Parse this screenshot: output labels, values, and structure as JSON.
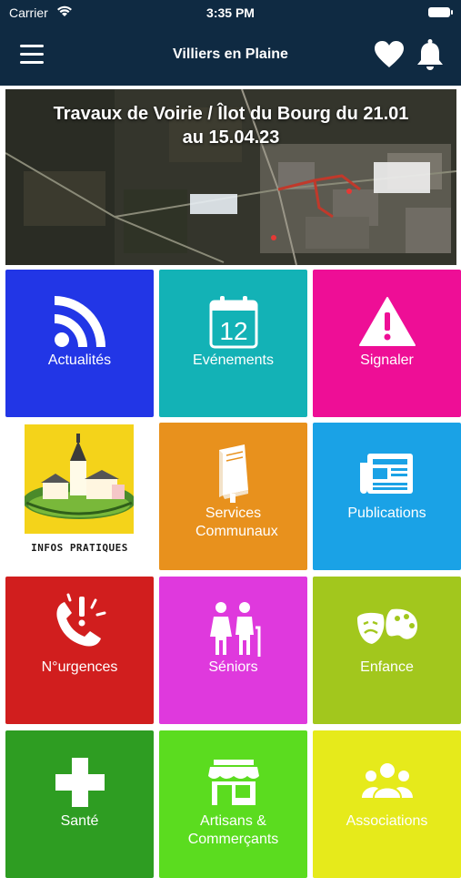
{
  "status_bar": {
    "carrier": "Carrier",
    "time": "3:35 PM"
  },
  "nav": {
    "title": "Villiers en Plaine",
    "menu_icon": "hamburger-menu-icon",
    "favorite_icon": "heart-icon",
    "notifications_icon": "bell-icon"
  },
  "banner": {
    "title": "Travaux de Voirie / Îlot du Bourg du 21.01 au 15.04.23"
  },
  "tiles": [
    {
      "label": "Actualités",
      "icon": "rss-icon",
      "color": "#2236e6"
    },
    {
      "label": "Evénements",
      "icon": "calendar-icon",
      "calendar_day": "12",
      "color": "#13b2b6"
    },
    {
      "label": "Signaler",
      "icon": "warning-icon",
      "color": "#ee0e96"
    },
    {
      "label": "INFOS PRATIQUES",
      "icon": "village-illustration",
      "color": "#ffffff"
    },
    {
      "label": "Services Communaux",
      "icon": "book-icon",
      "color": "#e8911d"
    },
    {
      "label": "Publications",
      "icon": "newspaper-icon",
      "color": "#1aa2e6"
    },
    {
      "label": "N°urgences",
      "icon": "emergency-phone-icon",
      "color": "#d11e1e"
    },
    {
      "label": "Séniors",
      "icon": "elderly-couple-icon",
      "color": "#df39dd"
    },
    {
      "label": "Enfance",
      "icon": "masks-palette-icon",
      "color": "#a2c71d"
    },
    {
      "label": "Santé",
      "icon": "medical-cross-icon",
      "color": "#2e9d22"
    },
    {
      "label": "Artisans & Commerçants",
      "icon": "shop-icon",
      "color": "#5bdc1f"
    },
    {
      "label": "Associations",
      "icon": "group-icon",
      "color": "#e6ea1b"
    }
  ]
}
